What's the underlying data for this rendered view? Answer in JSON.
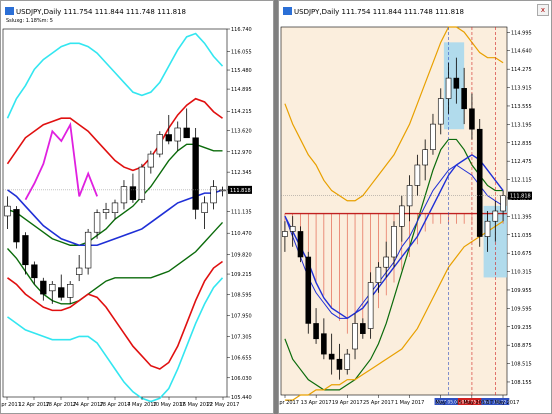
{
  "windows": [
    {
      "id": "left",
      "title": "USDJPY,Daily",
      "ohlc": "111.754 111.844 111.748 111.818",
      "subtitle": "Ssluxg: 1.18%m: 5",
      "price_label": "111.818",
      "y_ticks": [
        "116.740",
        "116.055",
        "115.480",
        "114.895",
        "114.215",
        "113.620",
        "112.970",
        "112.345",
        "111.800",
        "111.135",
        "110.470",
        "109.820",
        "109.215",
        "108.595",
        "107.950",
        "107.305",
        "106.655",
        "106.030",
        "105.440"
      ],
      "x_ticks": [
        "6 Apr 2017",
        "12 Apr 2017",
        "18 Apr 2017",
        "24 Apr 2017",
        "28 Apr 2017",
        "4 May 2017",
        "10 May 2017",
        "16 May 2017",
        "22 May 2017"
      ]
    },
    {
      "id": "right",
      "title": "USDJPY,Daily",
      "ohlc": "111.754 111.844 111.748 111.818",
      "price_label": "111.818",
      "y_ticks": [
        "114.995",
        "114.640",
        "114.275",
        "113.915",
        "113.555",
        "113.195",
        "112.835",
        "112.475",
        "112.115",
        "111.755",
        "111.395",
        "111.035",
        "110.675",
        "110.315",
        "109.955",
        "109.595",
        "109.235",
        "108.875",
        "108.515",
        "108.155"
      ],
      "x_ticks": [
        "7 Apr 2017",
        "13 Apr 2017",
        "19 Apr 2017",
        "25 Apr 2017",
        "1 May 2017",
        "May",
        "15 May 2017",
        "17 May 2017"
      ],
      "markers": [
        "2017.05.09 00:00",
        "2017.05.12",
        "2017.05.22 00:00"
      ]
    }
  ],
  "chart_data": [
    {
      "type": "candlestick",
      "title": "USDJPY,Daily",
      "ylim": [
        105.44,
        116.74
      ],
      "ohlc": [
        [
          111.0,
          111.6,
          110.6,
          111.3
        ],
        [
          111.2,
          111.3,
          110.0,
          110.2
        ],
        [
          110.4,
          110.5,
          109.2,
          109.5
        ],
        [
          109.5,
          109.6,
          108.9,
          109.1
        ],
        [
          109.0,
          109.1,
          108.4,
          108.6
        ],
        [
          108.7,
          109.0,
          108.3,
          108.9
        ],
        [
          108.8,
          109.2,
          108.4,
          108.5
        ],
        [
          108.5,
          109.0,
          108.3,
          108.9
        ],
        [
          109.2,
          109.8,
          109.0,
          109.4
        ],
        [
          109.4,
          110.6,
          109.2,
          110.5
        ],
        [
          110.5,
          111.2,
          110.3,
          111.1
        ],
        [
          111.1,
          111.4,
          110.9,
          111.2
        ],
        [
          111.1,
          111.5,
          110.9,
          111.4
        ],
        [
          111.4,
          112.1,
          111.2,
          111.9
        ],
        [
          111.9,
          112.3,
          111.4,
          111.5
        ],
        [
          111.5,
          112.6,
          111.4,
          112.5
        ],
        [
          112.5,
          113.0,
          112.3,
          112.9
        ],
        [
          112.9,
          113.6,
          112.8,
          113.5
        ],
        [
          113.5,
          114.1,
          113.2,
          113.3
        ],
        [
          113.3,
          113.9,
          113.0,
          113.7
        ],
        [
          113.7,
          114.3,
          113.4,
          113.4
        ],
        [
          113.4,
          113.7,
          110.9,
          111.2
        ],
        [
          111.1,
          111.6,
          110.6,
          111.4
        ],
        [
          111.4,
          112.1,
          111.2,
          111.9
        ],
        [
          111.8,
          111.9,
          111.6,
          111.8
        ]
      ]
    },
    {
      "type": "candlestick",
      "title": "USDJPY,Daily",
      "ylim": [
        107.9,
        115.1
      ],
      "ohlc": [
        [
          111.0,
          111.3,
          110.7,
          111.1
        ],
        [
          111.1,
          111.4,
          110.8,
          111.2
        ],
        [
          111.1,
          111.2,
          110.5,
          110.6
        ],
        [
          110.6,
          110.7,
          109.1,
          109.3
        ],
        [
          109.3,
          109.6,
          108.9,
          109.0
        ],
        [
          109.1,
          109.4,
          108.6,
          108.7
        ],
        [
          108.7,
          109.1,
          108.3,
          108.6
        ],
        [
          108.6,
          108.9,
          108.2,
          108.4
        ],
        [
          108.4,
          108.8,
          108.3,
          108.7
        ],
        [
          108.8,
          109.5,
          108.6,
          109.3
        ],
        [
          109.3,
          109.4,
          109.0,
          109.1
        ],
        [
          109.2,
          110.3,
          109.0,
          110.1
        ],
        [
          110.1,
          110.5,
          109.9,
          110.4
        ],
        [
          110.4,
          110.9,
          110.2,
          110.6
        ],
        [
          110.6,
          111.3,
          110.4,
          111.2
        ],
        [
          111.2,
          111.8,
          110.9,
          111.6
        ],
        [
          111.6,
          112.2,
          111.3,
          112.0
        ],
        [
          112.0,
          112.6,
          111.8,
          112.4
        ],
        [
          112.4,
          112.9,
          112.1,
          112.7
        ],
        [
          112.7,
          113.4,
          112.6,
          113.2
        ],
        [
          113.2,
          113.9,
          113.0,
          113.7
        ],
        [
          113.7,
          114.4,
          113.4,
          114.1
        ],
        [
          114.1,
          114.5,
          113.6,
          113.9
        ],
        [
          113.9,
          114.3,
          113.2,
          113.5
        ],
        [
          113.5,
          113.8,
          112.9,
          113.1
        ],
        [
          113.1,
          113.3,
          110.8,
          111.0
        ],
        [
          111.0,
          111.5,
          110.7,
          111.3
        ],
        [
          111.3,
          111.7,
          110.9,
          111.5
        ],
        [
          111.5,
          111.9,
          111.3,
          111.8
        ]
      ]
    }
  ]
}
